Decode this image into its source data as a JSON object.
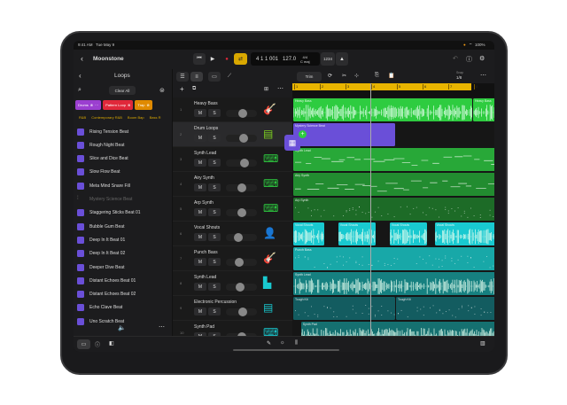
{
  "status": {
    "time": "9:41 AM",
    "date": "Tue May 9",
    "battery": "100%"
  },
  "control": {
    "project": "Moonstone",
    "position": "4 1 1 001",
    "tempo": "127.0",
    "signature": "4/4",
    "key": "C maj",
    "count_in": "1234"
  },
  "colors": {
    "accent": "#f0b400",
    "green": "#2ecc40",
    "purple": "#6a4fd8",
    "cyan": "#19c9d0",
    "teal": "#1a9a9a"
  },
  "loops": {
    "title": "Loops",
    "clear_all": "Clear All",
    "chips": [
      {
        "label": "Drums",
        "color": "#9b3fd0"
      },
      {
        "label": "Pattern Loop",
        "color": "#e0283a"
      },
      {
        "label": "Trap",
        "color": "#e08a00"
      }
    ],
    "genres": [
      "R&B",
      "Contemporary R&B",
      "Boom Bap",
      "Bass R"
    ],
    "items": [
      "Rising Tension Beat",
      "Rough Night Beat",
      "Slice and Dice Beat",
      "Slow Flow Beat",
      "Meta Mind Snare Fill",
      "Mystery Science Beat",
      "Staggering Sticks Beat 01",
      "Bubble Gum Beat",
      "Deep In It Beat 01",
      "Deep In It Beat 02",
      "Deeper Dive Beat",
      "Distant Echoes Beat 01",
      "Distant Echoes Beat 02",
      "Echo Clave Beat",
      "Uno Scratch Beat"
    ]
  },
  "tracks": [
    {
      "n": "1",
      "name": "Heavy Bass",
      "icon": "guitar-icon",
      "color": "#2ecc40",
      "vol": 0.55
    },
    {
      "n": "2",
      "name": "Drum Loops",
      "icon": "drum-machine-icon",
      "color": "#7ed321",
      "vol": 0.6
    },
    {
      "n": "3",
      "name": "Synth Lead",
      "icon": "keyboard-icon",
      "color": "#2ecc40",
      "vol": 0.65
    },
    {
      "n": "4",
      "name": "Airy Synth",
      "icon": "keyboard-icon",
      "color": "#2ecc40",
      "vol": 0.5
    },
    {
      "n": "5",
      "name": "Arp Synth",
      "icon": "keyboard-icon",
      "color": "#2ecc40",
      "vol": 0.5
    },
    {
      "n": "6",
      "name": "Vocal Shouts",
      "icon": "vocalist-icon",
      "color": "#19c9d0",
      "vol": 0.35
    },
    {
      "n": "7",
      "name": "Punch Bass",
      "icon": "guitar-icon",
      "color": "#19c9d0",
      "vol": 0.4
    },
    {
      "n": "8",
      "name": "Synth Lead",
      "icon": "equalizer-icon",
      "color": "#19c9d0",
      "vol": 0.45
    },
    {
      "n": "9",
      "name": "Electronic Percussion",
      "icon": "drum-machine-icon",
      "color": "#19c9d0",
      "vol": 0.55
    },
    {
      "n": "10",
      "name": "Synth Pad",
      "icon": "keyboard-icon",
      "color": "#19c9d0",
      "vol": 0.5
    }
  ],
  "ruler": [
    "1",
    "2",
    "3",
    "4",
    "5",
    "6",
    "7",
    "8"
  ],
  "snap": {
    "label": "Snap",
    "value": "1/8"
  },
  "tool": "Trim",
  "regions": [
    {
      "row": 0,
      "start": 1,
      "len": 7,
      "name": "Heavy Bass",
      "color": "#2ecc40",
      "kind": "audio"
    },
    {
      "row": 0,
      "start": 8,
      "len": 1,
      "name": "Heavy Bass",
      "color": "#2ecc40",
      "kind": "audio"
    },
    {
      "row": 1,
      "start": 1,
      "len": 4,
      "name": "Mystery Science Beat",
      "color": "#6a4fd8",
      "kind": "none"
    },
    {
      "row": 2,
      "start": 1,
      "len": 8,
      "name": "Synth Lead",
      "color": "#28a838",
      "kind": "midi"
    },
    {
      "row": 3,
      "start": 1,
      "len": 8,
      "name": "Airy Synth",
      "color": "#228c30",
      "kind": "midi"
    },
    {
      "row": 4,
      "start": 1,
      "len": 8,
      "name": "Arp Synth",
      "color": "#1d6b27",
      "kind": "dots"
    },
    {
      "row": 5,
      "start": 1,
      "len": 1.25,
      "name": "Vocal Shouts",
      "color": "#19c9d0",
      "kind": "audio"
    },
    {
      "row": 5,
      "start": 2.75,
      "len": 1.5,
      "name": "Vocal Shouts",
      "color": "#19c9d0",
      "kind": "audio"
    },
    {
      "row": 5,
      "start": 4.75,
      "len": 1.5,
      "name": "Vocal Shouts",
      "color": "#19c9d0",
      "kind": "audio"
    },
    {
      "row": 5,
      "start": 6.5,
      "len": 2.5,
      "name": "Vocal Shouts",
      "color": "#19c9d0",
      "kind": "audio"
    },
    {
      "row": 6,
      "start": 1,
      "len": 8,
      "name": "Punch Bass",
      "color": "#18a8a8",
      "kind": "dots"
    },
    {
      "row": 7,
      "start": 1,
      "len": 8,
      "name": "Synth Lead",
      "color": "#168080",
      "kind": "audio"
    },
    {
      "row": 8,
      "start": 1,
      "len": 4,
      "name": "Tough Kit",
      "color": "#135c60",
      "kind": "dots"
    },
    {
      "row": 8,
      "start": 5,
      "len": 4,
      "name": "Tough Kit",
      "color": "#135c60",
      "kind": "dots"
    },
    {
      "row": 9,
      "start": 1.3,
      "len": 7.7,
      "name": "Synth Pad",
      "color": "#157070",
      "kind": "audio"
    }
  ],
  "playhead_bar": 4
}
